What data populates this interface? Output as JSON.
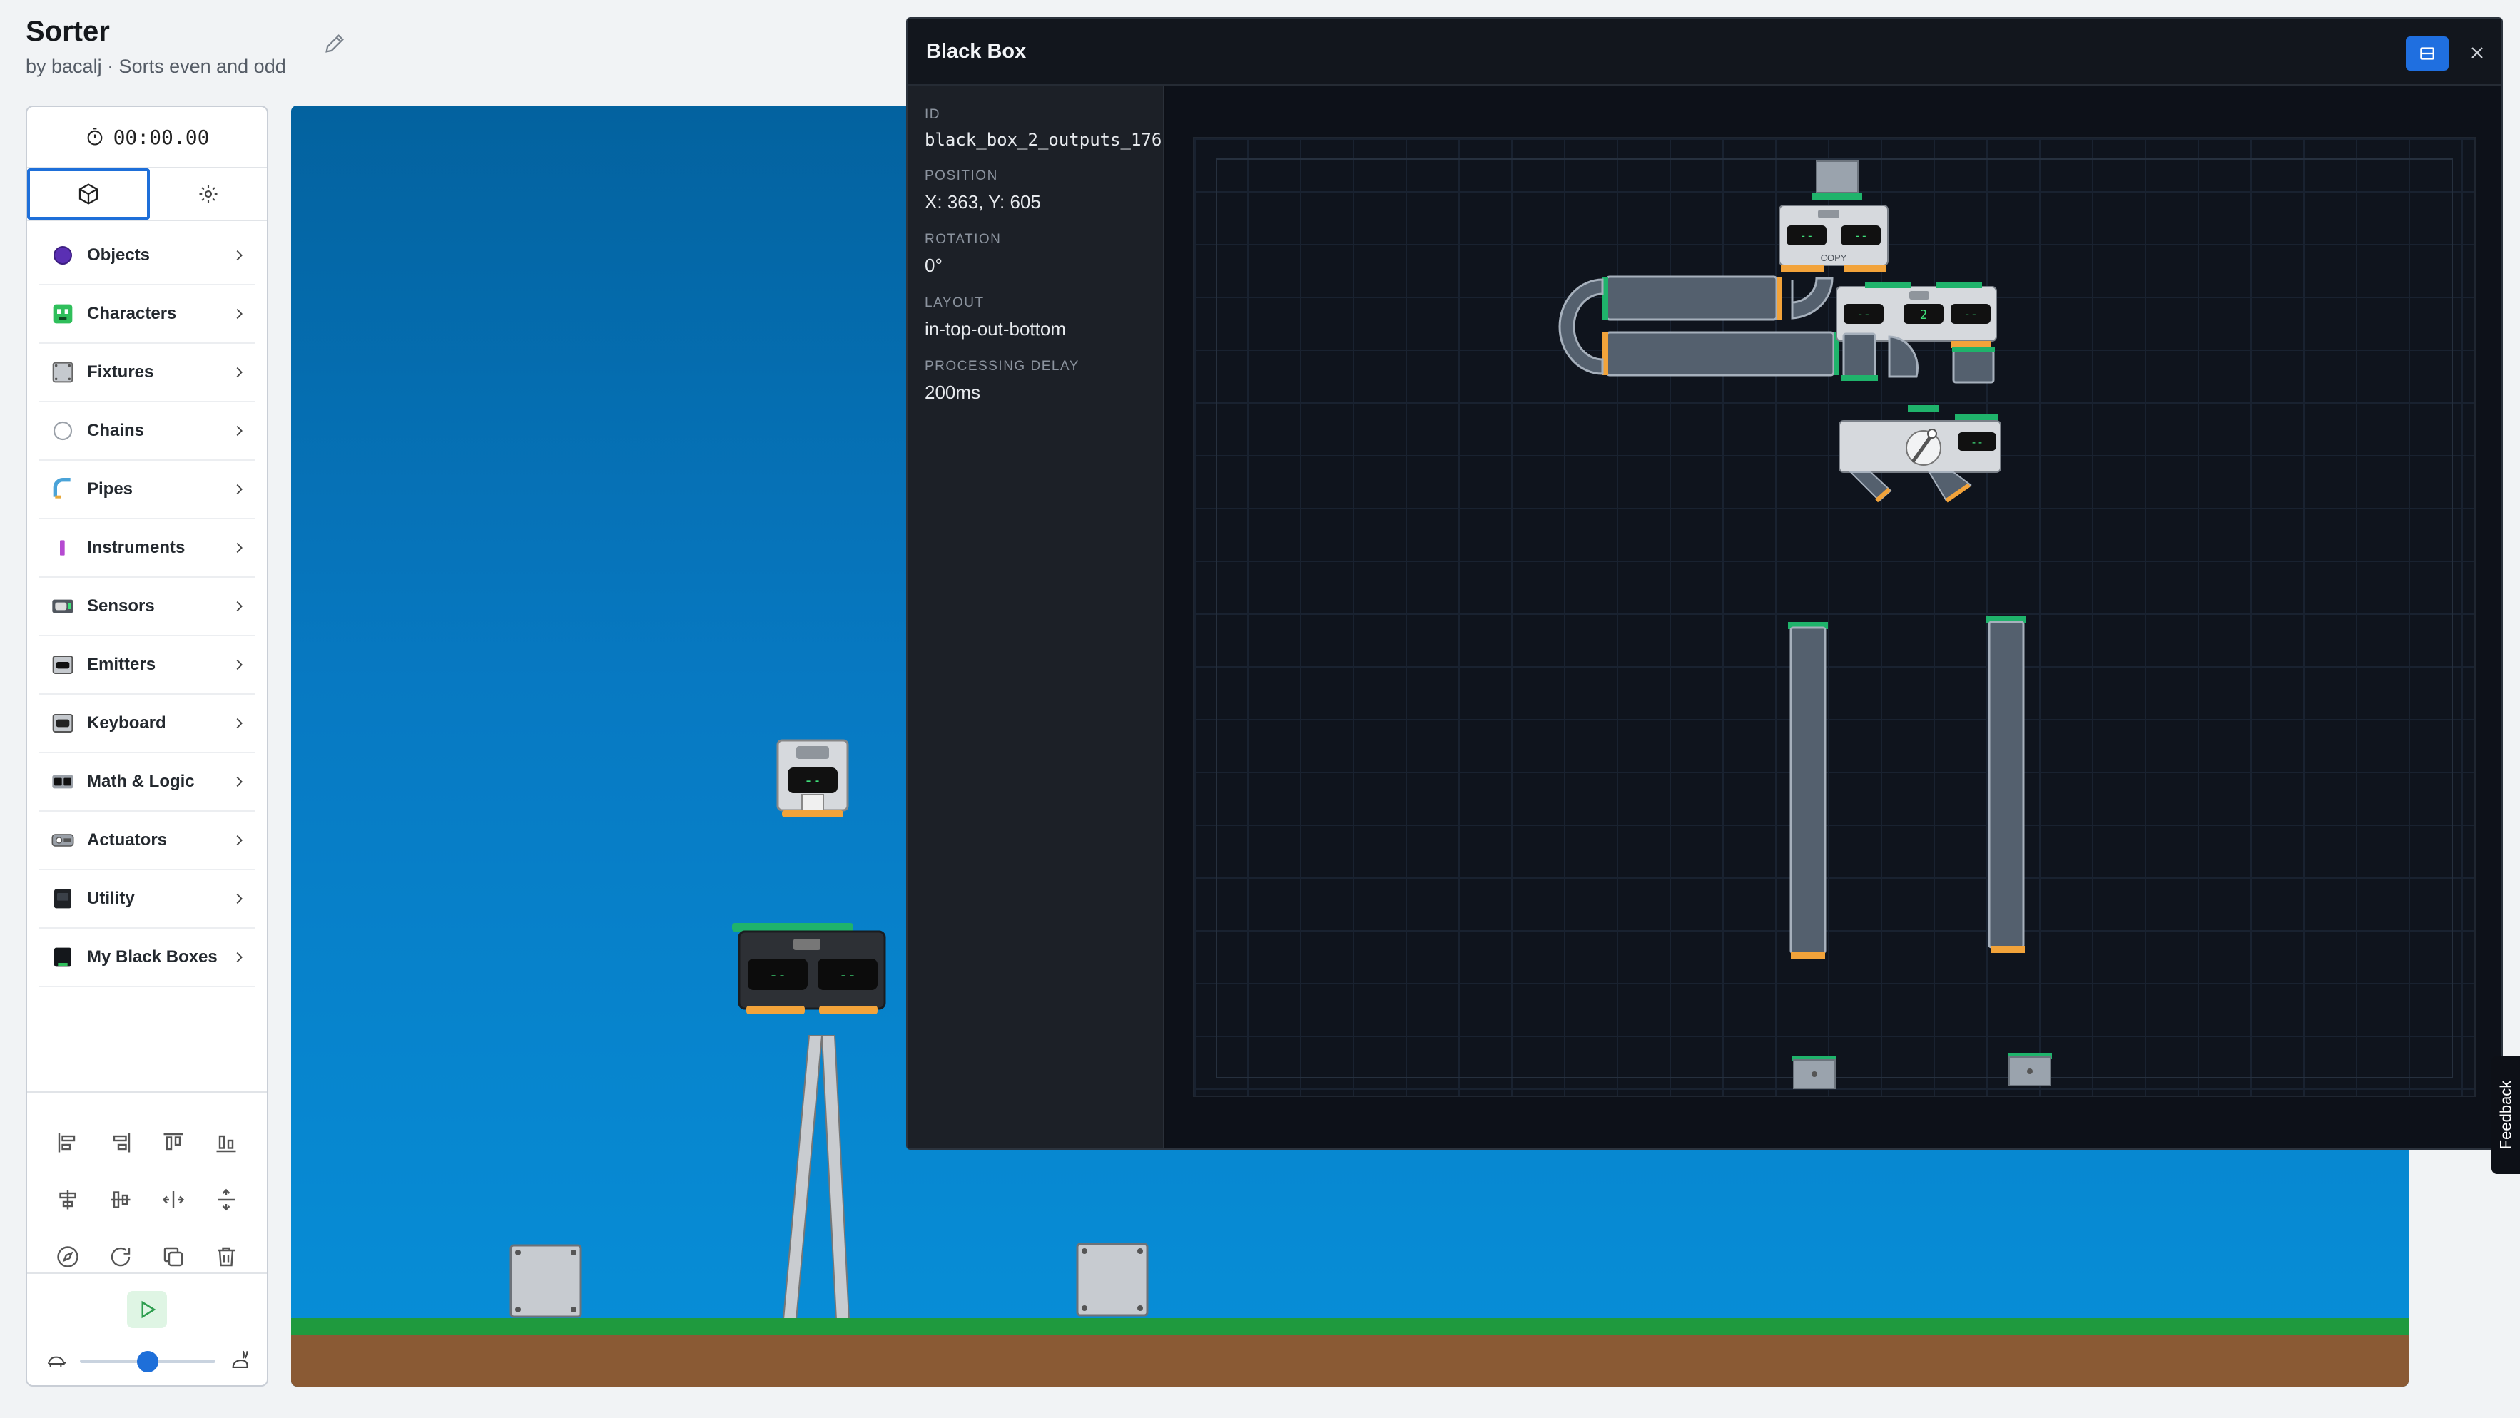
{
  "project": {
    "title": "Sorter",
    "subtitle": "by bacalj · Sorts even and odd"
  },
  "timer": {
    "value": "00:00.00"
  },
  "tabs": [
    {
      "name": "objects",
      "icon": "cube-icon",
      "active": true
    },
    {
      "name": "settings",
      "icon": "gear-icon",
      "active": false
    }
  ],
  "categories": [
    {
      "label": "Objects",
      "icon": "purple-circle-icon"
    },
    {
      "label": "Characters",
      "icon": "character-icon"
    },
    {
      "label": "Fixtures",
      "icon": "fixture-icon"
    },
    {
      "label": "Chains",
      "icon": "chain-icon"
    },
    {
      "label": "Pipes",
      "icon": "pipe-icon"
    },
    {
      "label": "Instruments",
      "icon": "instrument-icon"
    },
    {
      "label": "Sensors",
      "icon": "sensor-icon"
    },
    {
      "label": "Emitters",
      "icon": "emitter-icon"
    },
    {
      "label": "Keyboard",
      "icon": "keyboard-icon"
    },
    {
      "label": "Math & Logic",
      "icon": "math-logic-icon"
    },
    {
      "label": "Actuators",
      "icon": "actuator-icon"
    },
    {
      "label": "Utility",
      "icon": "utility-icon"
    },
    {
      "label": "My Black Boxes",
      "icon": "black-box-icon"
    }
  ],
  "speed": {
    "level": 0.5
  },
  "modal": {
    "title": "Black Box",
    "properties": [
      {
        "label": "ID",
        "value": "black_box_2_outputs_176"
      },
      {
        "label": "POSITION",
        "value": "X: 363, Y: 605"
      },
      {
        "label": "ROTATION",
        "value": "0°"
      },
      {
        "label": "LAYOUT",
        "value": "in-top-out-bottom"
      },
      {
        "label": "PROCESSING DELAY",
        "value": "200ms"
      }
    ],
    "copy_label": "COPY",
    "mod_value": "2"
  },
  "display_dash": "--",
  "feedback_label": "Feedback",
  "colors": {
    "accent": "#1e6fd9",
    "sky_top": "#03629f",
    "sky_bottom": "#078fd8",
    "grass": "#1f9a3e",
    "dirt": "#8a5a34",
    "port_green": "#1fb36b",
    "port_orange": "#f2a33a"
  }
}
